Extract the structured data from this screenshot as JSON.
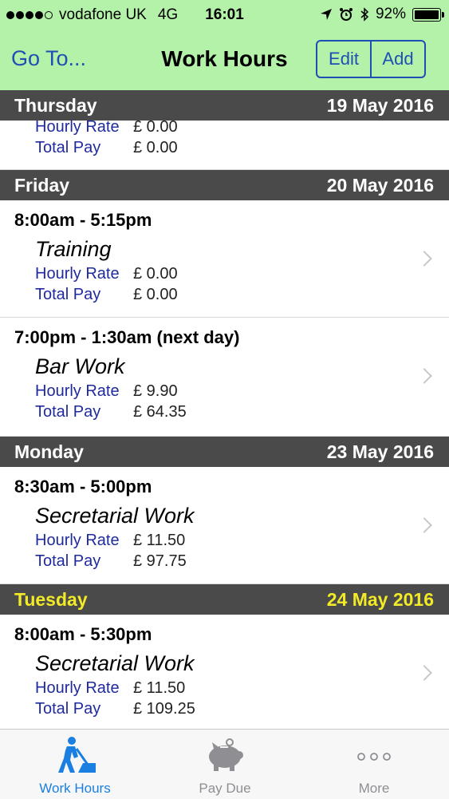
{
  "status_bar": {
    "carrier": "vodafone UK",
    "network": "4G",
    "time": "16:01",
    "battery": "92%",
    "battery_level": 0.92,
    "signal_bars_filled": 4
  },
  "nav": {
    "left_button": "Go To...",
    "title": "Work Hours",
    "edit": "Edit",
    "add": "Add"
  },
  "colors": {
    "nav_background": "#b3f2a8",
    "accent": "#1f4fb5",
    "section_header": "#4a4a4a",
    "today_highlight": "#f2ea26"
  },
  "sections": [
    {
      "day": "Thursday",
      "date": "19 May 2016",
      "entries": [
        {
          "rate_label": "Hourly Rate",
          "rate": "£ 0.00",
          "pay_label": "Total Pay",
          "pay": "£ 0.00"
        }
      ]
    },
    {
      "day": "Friday",
      "date": "20 May 2016",
      "entries": [
        {
          "time": "8:00am - 5:15pm",
          "job": "Training",
          "rate_label": "Hourly Rate",
          "rate": "£ 0.00",
          "pay_label": "Total Pay",
          "pay": "£ 0.00"
        },
        {
          "time": "7:00pm - 1:30am (next day)",
          "job": "Bar Work",
          "rate_label": "Hourly Rate",
          "rate": "£ 9.90",
          "pay_label": "Total Pay",
          "pay": "£ 64.35"
        }
      ]
    },
    {
      "day": "Monday",
      "date": "23 May 2016",
      "entries": [
        {
          "time": "8:30am - 5:00pm",
          "job": "Secretarial Work",
          "rate_label": "Hourly Rate",
          "rate": "£ 11.50",
          "pay_label": "Total Pay",
          "pay": "£ 97.75"
        }
      ]
    },
    {
      "day": "Tuesday",
      "date": "24 May 2016",
      "highlight": true,
      "entries": [
        {
          "time": "8:00am - 5:30pm",
          "job": "Secretarial Work",
          "rate_label": "Hourly Rate",
          "rate": "£ 11.50",
          "pay_label": "Total Pay",
          "pay": "£ 109.25"
        }
      ]
    }
  ],
  "tabs": [
    {
      "label": "Work Hours",
      "icon": "worker-digging-icon",
      "active": true
    },
    {
      "label": "Pay Due",
      "icon": "piggy-bank-icon",
      "active": false
    },
    {
      "label": "More",
      "icon": "more-dots-icon",
      "active": false
    }
  ]
}
